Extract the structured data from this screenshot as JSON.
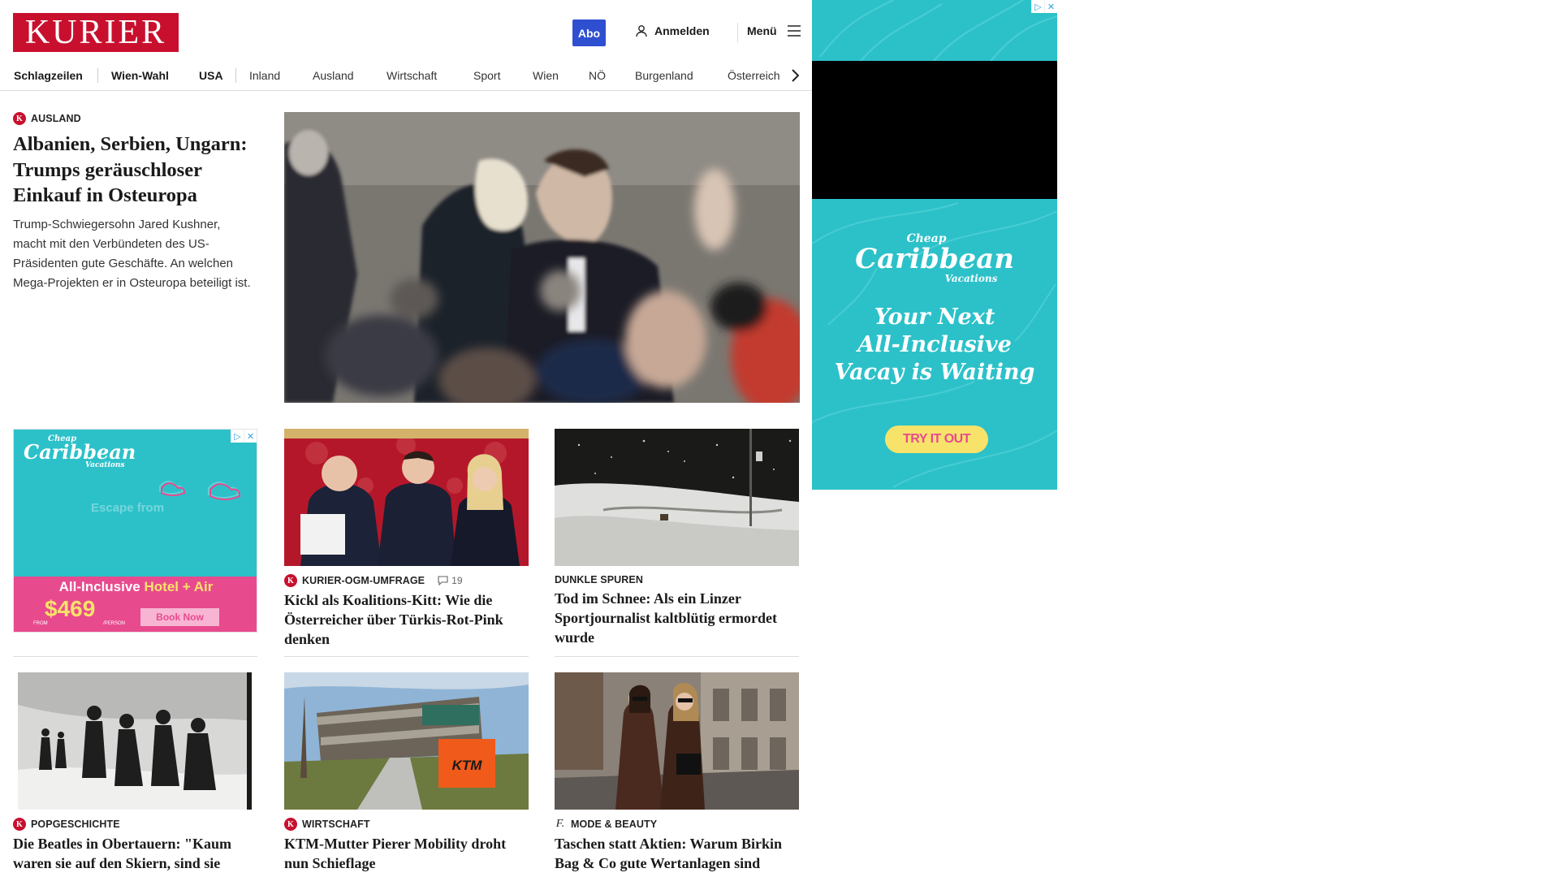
{
  "header": {
    "logo": "KURIER",
    "abo_label": "Abo",
    "login_label": "Anmelden",
    "menu_label": "Menü"
  },
  "nav": {
    "items": [
      "Schlagzeilen",
      "Wien-Wahl",
      "USA",
      "Inland",
      "Ausland",
      "Wirtschaft",
      "Sport",
      "Wien",
      "NÖ",
      "Burgenland",
      "Österreich"
    ]
  },
  "lead": {
    "kicker": "AUSLAND",
    "headline": "Albanien, Serbien, Ungarn: Trumps geräuschloser Einkauf in Osteuropa",
    "teaser": "Trump-Schwiegersohn Jared Kushner, macht mit den Verbündeten des US-Präsidenten gute Geschäfte. An welchen Mega-Projekten er in Osteuropa beteiligt ist."
  },
  "cards": [
    {
      "kicker": "KURIER-OGM-UMFRAGE",
      "comments": "19",
      "headline": "Kickl als Koalitions-Kitt: Wie die Österreicher über Türkis-Rot-Pink denken"
    },
    {
      "kicker": "DUNKLE SPUREN",
      "headline": "Tod im Schnee: Als ein Linzer Sportjournalist kaltblütig ermordet wurde"
    },
    {
      "kicker": "POPGESCHICHTE",
      "headline": "Die Beatles in Obertauern: \"Kaum waren sie auf den Skiern, sind sie umgefallen\""
    },
    {
      "kicker": "WIRTSCHAFT",
      "headline": "KTM-Mutter Pierer Mobility droht nun Schieflage"
    },
    {
      "kicker": "MODE & BEAUTY",
      "headline": "Taschen statt Aktien: Warum Birkin Bag & Co gute Wertanlagen sind"
    }
  ],
  "ad_small": {
    "brand_top": "Cheap",
    "brand": "Caribbean",
    "brand_bottom": "Vacations",
    "tagline_faded": "Escape from",
    "offer": "All-Inclusive",
    "offer_accent": "Hotel + Air",
    "price_from": "FROM",
    "price": "$469",
    "price_per": "/PERSON",
    "cta": "Book Now"
  },
  "ad_right": {
    "brand_top": "Cheap",
    "brand": "Caribbean",
    "brand_bottom": "Vacations",
    "line1": "Your Next",
    "line2": "All-Inclusive",
    "line3": "Vacay is Waiting",
    "cta": "TRY IT OUT"
  },
  "icons": {
    "ktm_sign": "KTM"
  },
  "colors": {
    "brand_red": "#c8102e",
    "abo_blue": "#2f4fd1",
    "ad_teal": "#2cc1c9",
    "ad_pink": "#e84a8e",
    "ad_yellow": "#f7e36a"
  }
}
